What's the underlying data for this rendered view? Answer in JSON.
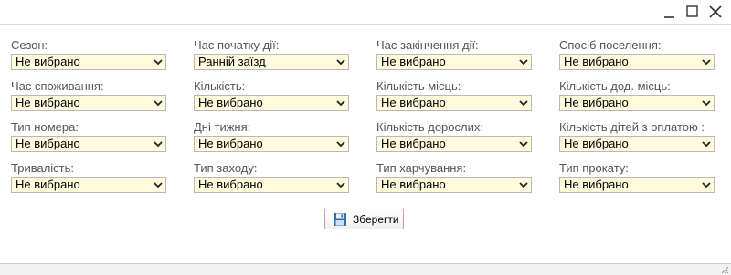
{
  "window": {
    "minimize_icon": "minimize-icon",
    "maximize_icon": "maximize-icon",
    "close_icon": "close-icon"
  },
  "fields": [
    {
      "label": "Сезон:",
      "value": "Не вибрано"
    },
    {
      "label": "Час початку дії:",
      "value": "Ранній заїзд"
    },
    {
      "label": "Час закінчення дії:",
      "value": "Не вибрано"
    },
    {
      "label": "Спосіб поселення:",
      "value": "Не вибрано"
    },
    {
      "label": "Час споживання:",
      "value": "Не вибрано"
    },
    {
      "label": "Кількість:",
      "value": "Не вибрано"
    },
    {
      "label": "Кількість місць:",
      "value": "Не вибрано"
    },
    {
      "label": "Кількість дод. місць:",
      "value": "Не вибрано"
    },
    {
      "label": "Тип номера:",
      "value": "Не вибрано"
    },
    {
      "label": "Дні тижня:",
      "value": "Не вибрано"
    },
    {
      "label": "Кількість дорослих:",
      "value": "Не вибрано"
    },
    {
      "label": "Кількість дітей з оплатою :",
      "value": "Не вибрано"
    },
    {
      "label": "Тривалість:",
      "value": "Не вибрано"
    },
    {
      "label": "Тип заходу:",
      "value": "Не вибрано"
    },
    {
      "label": "Тип харчування:",
      "value": "Не вибрано"
    },
    {
      "label": "Тип прокату:",
      "value": "Не вибрано"
    }
  ],
  "save_button": {
    "label": "Зберегти",
    "icon": "floppy-disk-icon"
  },
  "colors": {
    "select_bg": "#fffbdc",
    "save_border": "#d99b9b"
  }
}
